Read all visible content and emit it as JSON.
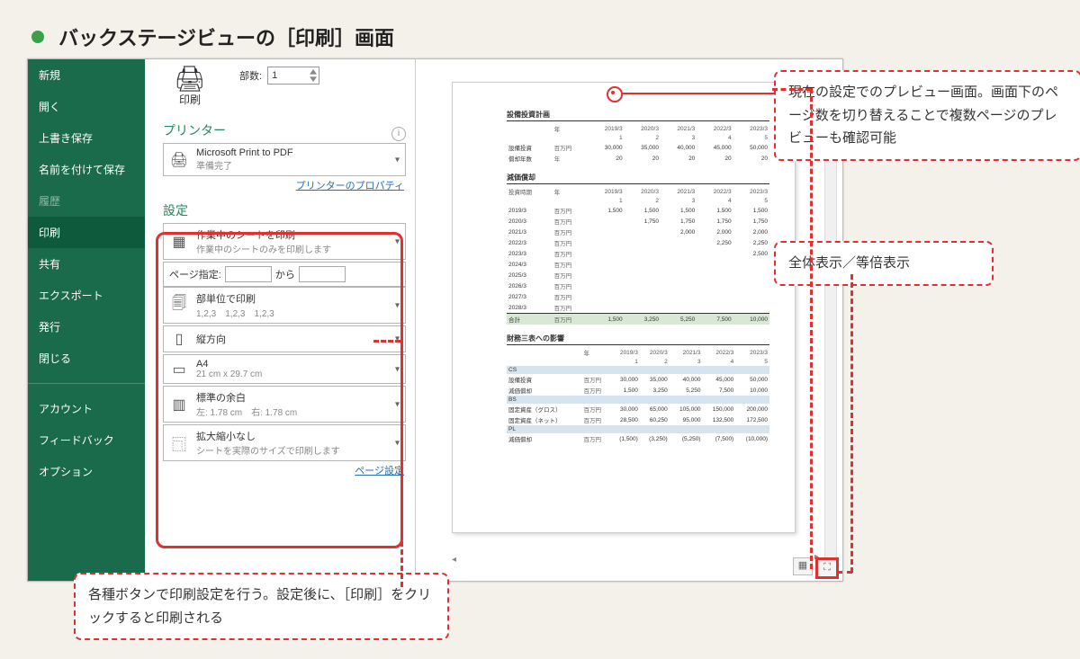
{
  "title": "バックステージビューの［印刷］画面",
  "sidebar": {
    "items": [
      {
        "label": "新規"
      },
      {
        "label": "開く"
      },
      {
        "label": "上書き保存"
      },
      {
        "label": "名前を付けて保存"
      },
      {
        "label": "履歴",
        "dim": true
      },
      {
        "label": "印刷",
        "active": true
      },
      {
        "label": "共有"
      },
      {
        "label": "エクスポート"
      },
      {
        "label": "発行"
      },
      {
        "label": "閉じる"
      }
    ],
    "footer": [
      {
        "label": "アカウント"
      },
      {
        "label": "フィードバック"
      },
      {
        "label": "オプション"
      }
    ]
  },
  "print": {
    "button_label": "印刷",
    "copies_label": "部数:",
    "copies_value": "1",
    "printer_heading": "プリンター",
    "printer_name": "Microsoft Print to PDF",
    "printer_status": "準備完了",
    "printer_props_link": "プリンターのプロパティ",
    "settings_heading": "設定",
    "print_what": {
      "title": "作業中のシートを印刷",
      "sub": "作業中のシートのみを印刷します"
    },
    "page_range_label": "ページ指定:",
    "page_range_from": "",
    "page_range_sep": "から",
    "page_range_to": "",
    "collate": {
      "title": "部単位で印刷",
      "sub": "1,2,3　1,2,3　1,2,3"
    },
    "orientation": {
      "title": "縦方向"
    },
    "paper": {
      "title": "A4",
      "sub": "21 cm x 29.7 cm"
    },
    "margins": {
      "title": "標準の余白",
      "sub": "左: 1.78 cm　右: 1.78 cm"
    },
    "scaling": {
      "title": "拡大縮小なし",
      "sub": "シートを実際のサイズで印刷します"
    },
    "page_setup_link": "ページ設定"
  },
  "callouts": {
    "preview": "現在の設定でのプレビュー画面。画面下のページ数を切り替えることで複数ページのプレビューも確認可能",
    "zoom": "全体表示／等倍表示",
    "settings": "各種ボタンで印刷設定を行う。設定後に、［印刷］をクリックすると印刷される"
  },
  "chart_data": [
    {
      "type": "table",
      "title": "設備投資計画",
      "columns": [
        "",
        "年",
        "2019/3",
        "2020/3",
        "2021/3",
        "2022/3",
        "2023/3"
      ],
      "index_row": [
        "",
        "",
        "1",
        "2",
        "3",
        "4",
        "5"
      ],
      "rows": [
        {
          "label": "設備投資",
          "unit": "百万円",
          "values": [
            30000,
            35000,
            40000,
            45000,
            50000
          ]
        },
        {
          "label": "償却年数",
          "unit": "年",
          "values": [
            20,
            20,
            20,
            20,
            20
          ]
        }
      ]
    },
    {
      "type": "table",
      "title": "減価償却",
      "columns": [
        "投資時期",
        "年",
        "2019/3",
        "2020/3",
        "2021/3",
        "2022/3",
        "2023/3"
      ],
      "index_row": [
        "",
        "",
        "1",
        "2",
        "3",
        "4",
        "5"
      ],
      "rows": [
        {
          "label": "2019/3",
          "unit": "百万円",
          "values": [
            1500,
            1500,
            1500,
            1500,
            1500
          ]
        },
        {
          "label": "2020/3",
          "unit": "百万円",
          "values": [
            null,
            1750,
            1750,
            1750,
            1750
          ]
        },
        {
          "label": "2021/3",
          "unit": "百万円",
          "values": [
            null,
            null,
            2000,
            2000,
            2000
          ]
        },
        {
          "label": "2022/3",
          "unit": "百万円",
          "values": [
            null,
            null,
            null,
            2250,
            2250
          ]
        },
        {
          "label": "2023/3",
          "unit": "百万円",
          "values": [
            null,
            null,
            null,
            null,
            2500
          ]
        },
        {
          "label": "2024/3",
          "unit": "百万円",
          "values": [
            null,
            null,
            null,
            null,
            null
          ]
        },
        {
          "label": "2025/3",
          "unit": "百万円",
          "values": [
            null,
            null,
            null,
            null,
            null
          ]
        },
        {
          "label": "2026/3",
          "unit": "百万円",
          "values": [
            null,
            null,
            null,
            null,
            null
          ]
        },
        {
          "label": "2027/3",
          "unit": "百万円",
          "values": [
            null,
            null,
            null,
            null,
            null
          ]
        },
        {
          "label": "2028/3",
          "unit": "百万円",
          "values": [
            null,
            null,
            null,
            null,
            null
          ]
        },
        {
          "label": "合計",
          "unit": "百万円",
          "values": [
            1500,
            3250,
            5250,
            7500,
            10000
          ],
          "total": true
        }
      ]
    },
    {
      "type": "table",
      "title": "財務三表への影響",
      "columns": [
        "",
        "年",
        "2019/3",
        "2020/3",
        "2021/3",
        "2022/3",
        "2023/3"
      ],
      "index_row": [
        "",
        "",
        "1",
        "2",
        "3",
        "4",
        "5"
      ],
      "sections": [
        {
          "name": "CS",
          "rows": [
            {
              "label": "設備投資",
              "unit": "百万円",
              "values": [
                30000,
                35000,
                40000,
                45000,
                50000
              ]
            },
            {
              "label": "減価償却",
              "unit": "百万円",
              "values": [
                1500,
                3250,
                5250,
                7500,
                10000
              ]
            }
          ]
        },
        {
          "name": "BS",
          "rows": [
            {
              "label": "固定資産（グロス）",
              "unit": "百万円",
              "values": [
                30000,
                65000,
                105000,
                150000,
                200000
              ]
            },
            {
              "label": "固定資産（ネット）",
              "unit": "百万円",
              "values": [
                28500,
                60250,
                95000,
                132500,
                172500
              ]
            }
          ]
        },
        {
          "name": "PL",
          "rows": [
            {
              "label": "減価償却",
              "unit": "百万円",
              "values": [
                -1500,
                -3250,
                -5250,
                -7500,
                -10000
              ]
            }
          ]
        }
      ]
    }
  ]
}
